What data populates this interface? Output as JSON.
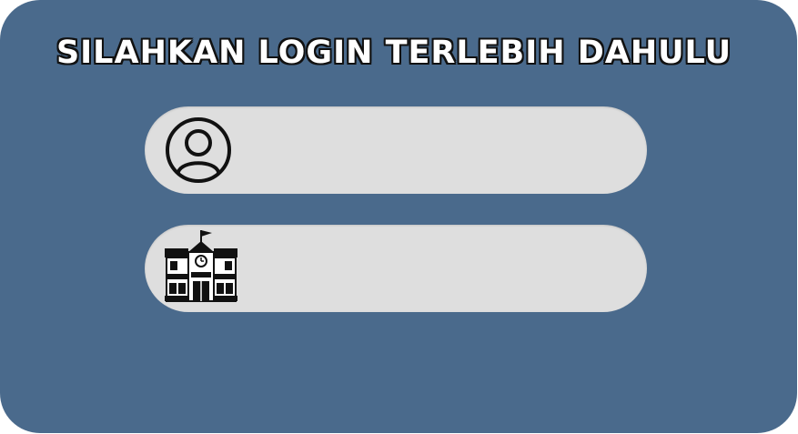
{
  "login_card": {
    "title": "SILAHKAN LOGIN TERLEBIH DAHULU",
    "background_color": "#4a6a8c",
    "fields": [
      {
        "name": "username",
        "icon": "user-icon",
        "value": "",
        "placeholder": ""
      },
      {
        "name": "school",
        "icon": "school-icon",
        "value": "",
        "placeholder": ""
      }
    ]
  }
}
